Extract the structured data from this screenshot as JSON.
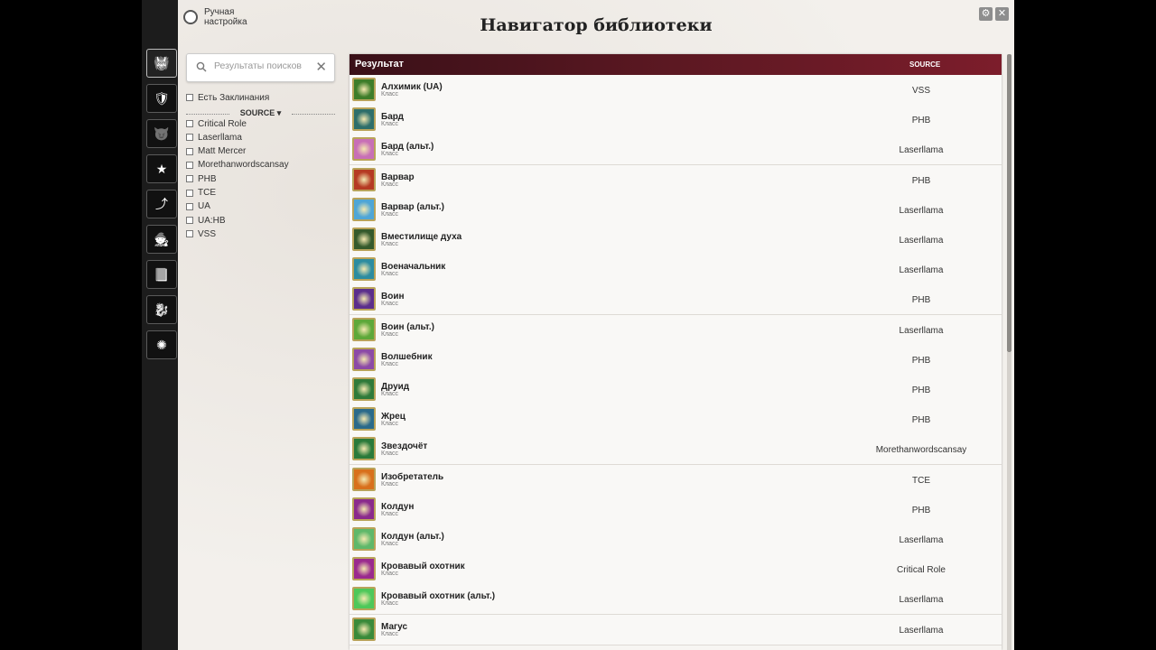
{
  "window": {
    "title": "Навигатор библиотеки",
    "manual_setting_label": "Ручная настройка"
  },
  "search": {
    "placeholder": "Результаты поисков",
    "value": ""
  },
  "filters": {
    "spells_label": "Есть Заклинания",
    "source_header": "SOURCE",
    "sources": [
      "Critical Role",
      "Laserllama",
      "Matt Mercer",
      "Morethanwordscansay",
      "PHB",
      "TCE",
      "UA",
      "UA:HB",
      "VSS"
    ]
  },
  "results": {
    "col_result": "Результат",
    "col_source": "SOURCE",
    "rows": [
      {
        "name": "Алхимик (UA)",
        "type": "Класс",
        "source": "VSS",
        "icon_color": "#3e7d2a"
      },
      {
        "name": "Бард",
        "type": "Класс",
        "source": "PHB",
        "icon_color": "#2e6e6a"
      },
      {
        "name": "Бард (альт.)",
        "type": "Класс",
        "source": "Laserllama",
        "icon_color": "#c86fb6"
      },
      {
        "name": "Варвар",
        "type": "Класс",
        "source": "PHB",
        "icon_color": "#b53a23"
      },
      {
        "name": "Варвар (альт.)",
        "type": "Класс",
        "source": "Laserllama",
        "icon_color": "#4fa6d6"
      },
      {
        "name": "Вместилище духа",
        "type": "Класс",
        "source": "Laserllama",
        "icon_color": "#355a2c"
      },
      {
        "name": "Военачальник",
        "type": "Класс",
        "source": "Laserllama",
        "icon_color": "#2c8ca0"
      },
      {
        "name": "Воин",
        "type": "Класс",
        "source": "PHB",
        "icon_color": "#5b2e8c"
      },
      {
        "name": "Воин (альт.)",
        "type": "Класс",
        "source": "Laserllama",
        "icon_color": "#5ea83a"
      },
      {
        "name": "Волшебник",
        "type": "Класс",
        "source": "PHB",
        "icon_color": "#8c4aa6"
      },
      {
        "name": "Друид",
        "type": "Класс",
        "source": "PHB",
        "icon_color": "#2f7a3a"
      },
      {
        "name": "Жрец",
        "type": "Класс",
        "source": "PHB",
        "icon_color": "#2a6a8a"
      },
      {
        "name": "Звездочёт",
        "type": "Класс",
        "source": "Morethanwordscansay",
        "icon_color": "#2a7a3a"
      },
      {
        "name": "Изобретатель",
        "type": "Класс",
        "source": "TCE",
        "icon_color": "#d8701c"
      },
      {
        "name": "Колдун",
        "type": "Класс",
        "source": "PHB",
        "icon_color": "#8a2a8c"
      },
      {
        "name": "Колдун (альт.)",
        "type": "Класс",
        "source": "Laserllama",
        "icon_color": "#5fb86a"
      },
      {
        "name": "Кровавый охотник",
        "type": "Класс",
        "source": "Critical Role",
        "icon_color": "#9a2a8e"
      },
      {
        "name": "Кровавый охотник (альт.)",
        "type": "Класс",
        "source": "Laserllama",
        "icon_color": "#4ec85a"
      },
      {
        "name": "Магус",
        "type": "Класс",
        "source": "Laserllama",
        "icon_color": "#3a8a3a"
      }
    ]
  },
  "rail": {
    "icons": [
      "monster-icon",
      "npc-icon",
      "creature-icon",
      "star-icon",
      "travel-icon",
      "character-icon",
      "book-icon",
      "dragon-icon",
      "sun-icon"
    ]
  }
}
